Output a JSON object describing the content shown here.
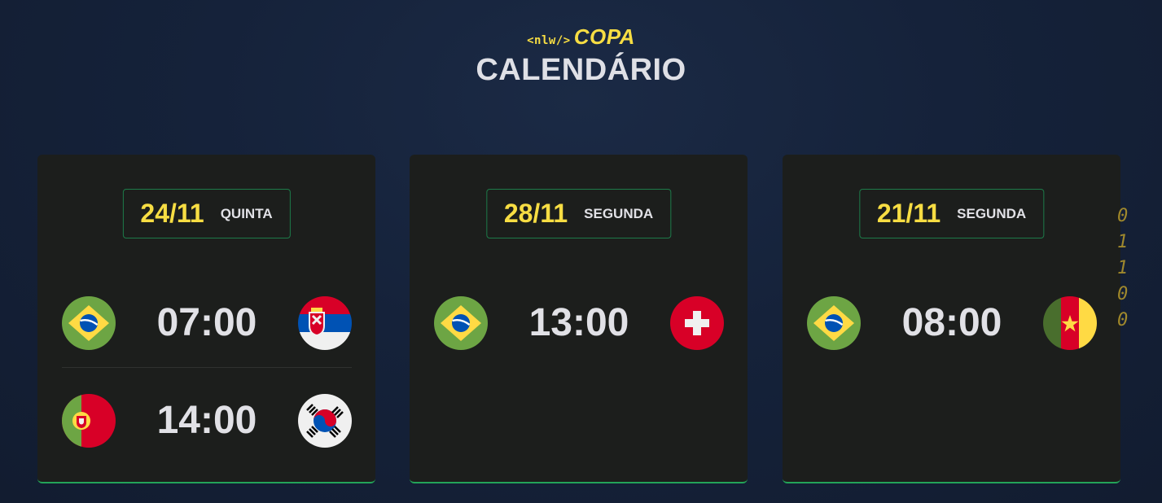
{
  "header": {
    "logo_code": "<nlw/>",
    "logo_copa": "COPA",
    "title": "CALENDÁRIO"
  },
  "cards": [
    {
      "date": "24/11",
      "weekday": "QUINTA",
      "matches": [
        {
          "home": "Brasil",
          "home_flag": "brazil-flag-icon",
          "time": "07:00",
          "away": "Sérvia",
          "away_flag": "serbia-flag-icon"
        },
        {
          "home": "Portugal",
          "home_flag": "portugal-flag-icon",
          "time": "14:00",
          "away": "Coreia do Sul",
          "away_flag": "south-korea-flag-icon"
        }
      ]
    },
    {
      "date": "28/11",
      "weekday": "SEGUNDA",
      "matches": [
        {
          "home": "Brasil",
          "home_flag": "brazil-flag-icon",
          "time": "13:00",
          "away": "Suíça",
          "away_flag": "switzerland-flag-icon"
        }
      ]
    },
    {
      "date": "21/11",
      "weekday": "SEGUNDA",
      "matches": [
        {
          "home": "Brasil",
          "home_flag": "brazil-flag-icon",
          "time": "08:00",
          "away": "Camarões",
          "away_flag": "cameroon-flag-icon"
        }
      ]
    }
  ],
  "decoration": {
    "binary_digits": [
      "0",
      "1",
      "1",
      "0",
      "0"
    ]
  },
  "colors": {
    "accent_yellow": "#f7dd43",
    "accent_green": "#23a359",
    "card_bg": "#1c1e1c",
    "page_bg": "#15223a"
  }
}
